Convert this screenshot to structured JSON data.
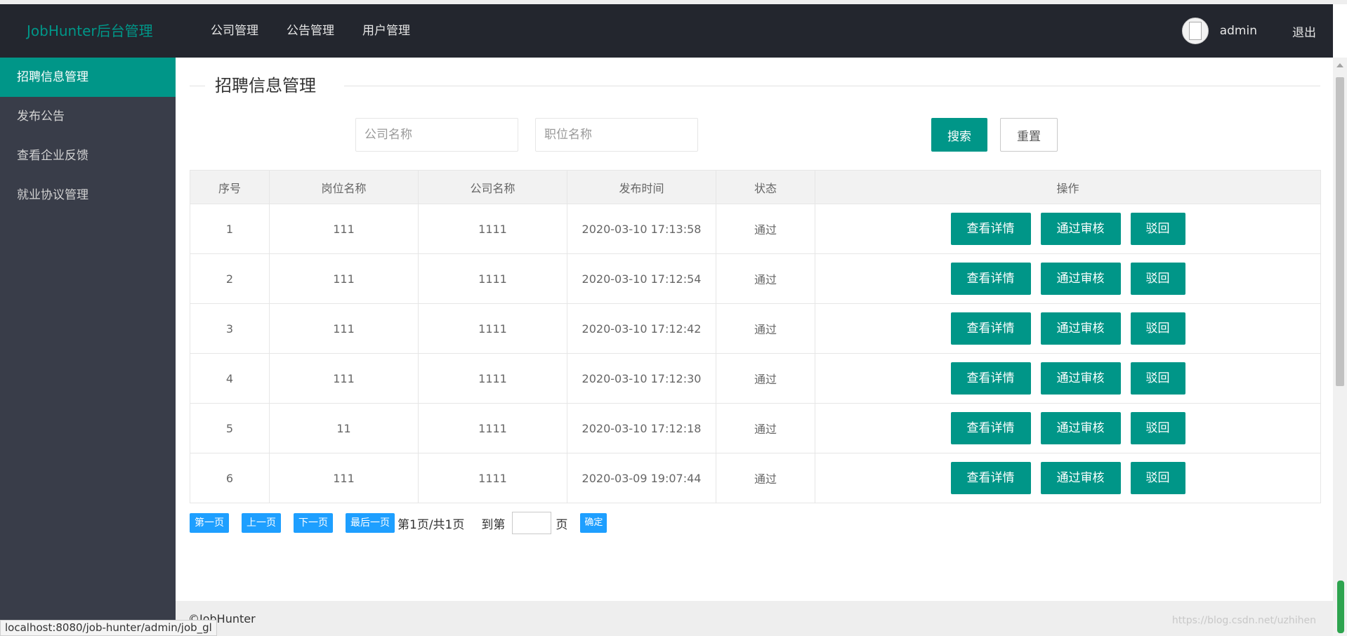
{
  "header": {
    "logo": "JobHunter后台管理",
    "nav": [
      "公司管理",
      "公告管理",
      "用户管理"
    ],
    "username": "admin",
    "logout": "退出"
  },
  "sidebar": {
    "items": [
      {
        "label": "招聘信息管理",
        "active": true
      },
      {
        "label": "发布公告",
        "active": false
      },
      {
        "label": "查看企业反馈",
        "active": false
      },
      {
        "label": "就业协议管理",
        "active": false
      }
    ]
  },
  "main": {
    "title": "招聘信息管理",
    "search": {
      "company_placeholder": "公司名称",
      "position_placeholder": "职位名称",
      "search_label": "搜索",
      "reset_label": "重置"
    },
    "table": {
      "headers": [
        "序号",
        "岗位名称",
        "公司名称",
        "发布时间",
        "状态",
        "操作"
      ],
      "rows": [
        {
          "index": "1",
          "position": "111",
          "company": "1111",
          "time": "2020-03-10 17:13:58",
          "status": "通过"
        },
        {
          "index": "2",
          "position": "111",
          "company": "1111",
          "time": "2020-03-10 17:12:54",
          "status": "通过"
        },
        {
          "index": "3",
          "position": "111",
          "company": "1111",
          "time": "2020-03-10 17:12:42",
          "status": "通过"
        },
        {
          "index": "4",
          "position": "111",
          "company": "1111",
          "time": "2020-03-10 17:12:30",
          "status": "通过"
        },
        {
          "index": "5",
          "position": "11",
          "company": "1111",
          "time": "2020-03-10 17:12:18",
          "status": "通过"
        },
        {
          "index": "6",
          "position": "111",
          "company": "1111",
          "time": "2020-03-09 19:07:44",
          "status": "通过"
        }
      ],
      "actions": {
        "detail": "查看详情",
        "approve": "通过审核",
        "reject": "驳回"
      }
    },
    "pagination": {
      "first": "第一页",
      "prev": "上一页",
      "next": "下一页",
      "last": "最后一页",
      "info": "第1页/共1页",
      "goto_label": "到第",
      "page_label": "页",
      "confirm": "确定"
    }
  },
  "footer": {
    "copyright": "©JobHunter",
    "watermark": "https://blog.csdn.net/uzhihen"
  },
  "statusbar": {
    "url": "localhost:8080/job-hunter/admin/job_gl"
  }
}
